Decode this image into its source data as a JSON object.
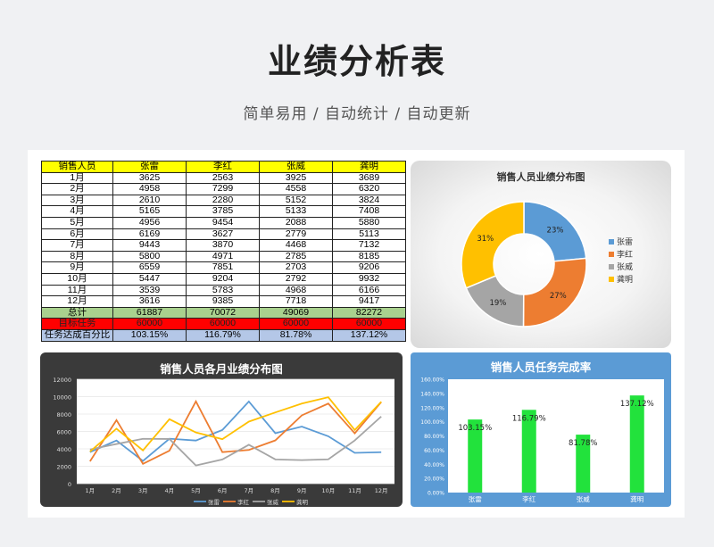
{
  "header": {
    "title": "业绩分析表",
    "subtitle": "简单易用 / 自动统计 / 自动更新"
  },
  "table": {
    "columns": [
      "销售人员",
      "张雷",
      "李红",
      "张威",
      "龚明"
    ],
    "rows": [
      [
        "1月",
        "3625",
        "2563",
        "3925",
        "3689"
      ],
      [
        "2月",
        "4958",
        "7299",
        "4558",
        "6320"
      ],
      [
        "3月",
        "2610",
        "2280",
        "5152",
        "3824"
      ],
      [
        "4月",
        "5165",
        "3785",
        "5133",
        "7408"
      ],
      [
        "5月",
        "4956",
        "9454",
        "2088",
        "5880"
      ],
      [
        "6月",
        "6169",
        "3627",
        "2779",
        "5113"
      ],
      [
        "7月",
        "9443",
        "3870",
        "4468",
        "7132"
      ],
      [
        "8月",
        "5800",
        "4971",
        "2785",
        "8185"
      ],
      [
        "9月",
        "6559",
        "7851",
        "2703",
        "9206"
      ],
      [
        "10月",
        "5447",
        "9204",
        "2792",
        "9932"
      ],
      [
        "11月",
        "3539",
        "5783",
        "4968",
        "6166"
      ],
      [
        "12月",
        "3616",
        "9385",
        "7718",
        "9417"
      ]
    ],
    "total": [
      "总计",
      "61887",
      "70072",
      "49069",
      "82272"
    ],
    "target": [
      "目标任务",
      "60000",
      "60000",
      "60000",
      "60000"
    ],
    "rate": [
      "任务达成百分比",
      "103.15%",
      "116.79%",
      "81.78%",
      "137.12%"
    ]
  },
  "colors": {
    "张雷": "#5b9bd5",
    "李红": "#ed7d31",
    "张威": "#a5a5a5",
    "龚明": "#ffc000",
    "bar": "#22e23c"
  },
  "chart_data": [
    {
      "type": "pie",
      "title": "销售人员业绩分布图",
      "categories": [
        "张雷",
        "李红",
        "张威",
        "龚明"
      ],
      "values": [
        61887,
        70072,
        49069,
        82272
      ],
      "labels": [
        "23%",
        "27%",
        "19%",
        "31%"
      ],
      "legend": "right"
    },
    {
      "type": "line",
      "title": "销售人员各月业绩分布图",
      "categories": [
        "1月",
        "2月",
        "3月",
        "4月",
        "5月",
        "6月",
        "7月",
        "8月",
        "9月",
        "10月",
        "11月",
        "12月"
      ],
      "series": [
        {
          "name": "张雷",
          "values": [
            3625,
            4958,
            2610,
            5165,
            4956,
            6169,
            9443,
            5800,
            6559,
            5447,
            3539,
            3616
          ]
        },
        {
          "name": "李红",
          "values": [
            2563,
            7299,
            2280,
            3785,
            9454,
            3627,
            3870,
            4971,
            7851,
            9204,
            5783,
            9385
          ]
        },
        {
          "name": "张威",
          "values": [
            3925,
            4558,
            5152,
            5133,
            2088,
            2779,
            4468,
            2785,
            2703,
            2792,
            4968,
            7718
          ]
        },
        {
          "name": "龚明",
          "values": [
            3689,
            6320,
            3824,
            7408,
            5880,
            5113,
            7132,
            8185,
            9206,
            9932,
            6166,
            9417
          ]
        }
      ],
      "yticks": [
        "0",
        "2000",
        "4000",
        "6000",
        "8000",
        "10000",
        "12000"
      ],
      "ylim": [
        0,
        12000
      ],
      "legend": "bottom"
    },
    {
      "type": "bar",
      "title": "销售人员任务完成率",
      "categories": [
        "张雷",
        "李红",
        "张威",
        "龚明"
      ],
      "values": [
        103.15,
        116.79,
        81.78,
        137.12
      ],
      "labels": [
        "103.15%",
        "116.79%",
        "81.78%",
        "137.12%"
      ],
      "yticks": [
        "0.00%",
        "20.00%",
        "40.00%",
        "60.00%",
        "80.00%",
        "100.00%",
        "120.00%",
        "140.00%",
        "160.00%"
      ],
      "ylim": [
        0,
        160
      ]
    }
  ]
}
